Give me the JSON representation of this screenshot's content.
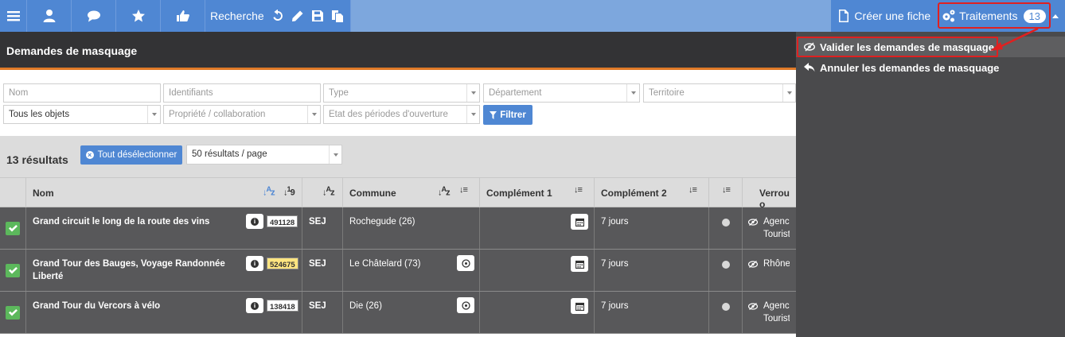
{
  "topbar": {
    "recherche_label": "Recherche",
    "creer_label": "Créer une fiche",
    "traitements_label": "Traitements",
    "traitements_count": "13"
  },
  "page_title": "Demandes de masquage",
  "filters": {
    "nom_placeholder": "Nom",
    "identifiants_placeholder": "Identifiants",
    "type_placeholder": "Type",
    "departement_placeholder": "Département",
    "territoire_placeholder": "Territoire",
    "objets_value": "Tous les objets",
    "propriete_placeholder": "Propriété / collaboration",
    "etat_placeholder": "Etat des périodes d'ouverture",
    "filtrer_label": "Filtrer"
  },
  "results": {
    "count_label": "13 résultats",
    "deselect_label": "Tout désélectionner",
    "perpage_value": "50 résultats / page"
  },
  "table": {
    "headers": {
      "nom": "Nom",
      "commune": "Commune",
      "complement1": "Complément 1",
      "complement2": "Complément 2",
      "verrou": "Verrou o"
    },
    "rows": [
      {
        "name": "Grand circuit le long de la route des vins",
        "id": "491128",
        "type": "SEJ",
        "commune": "Rochegude (26)",
        "complement2": "7 jours",
        "verrou": "Agence",
        "verrou2": "Touristiq"
      },
      {
        "name": "Grand Tour des Bauges, Voyage Randonnée Liberté",
        "id": "524675",
        "type": "SEJ",
        "commune": "Le Châtelard (73)",
        "complement2": "7 jours",
        "verrou": "Rhône-A",
        "verrou2": ""
      },
      {
        "name": "Grand Tour du Vercors à vélo",
        "id": "138418",
        "type": "SEJ",
        "commune": "Die (26)",
        "complement2": "7 jours",
        "verrou": "Agence",
        "verrou2": "Touristiq"
      }
    ]
  },
  "dropdown": {
    "valider_label": "Valider les demandes de masquage",
    "annuler_label": "Annuler les demandes de masquage"
  },
  "colors": {
    "nav_blue": "#4f87d3",
    "accent_orange": "#e07a28",
    "highlight_red": "#e02020",
    "check_green": "#5cb85c"
  }
}
